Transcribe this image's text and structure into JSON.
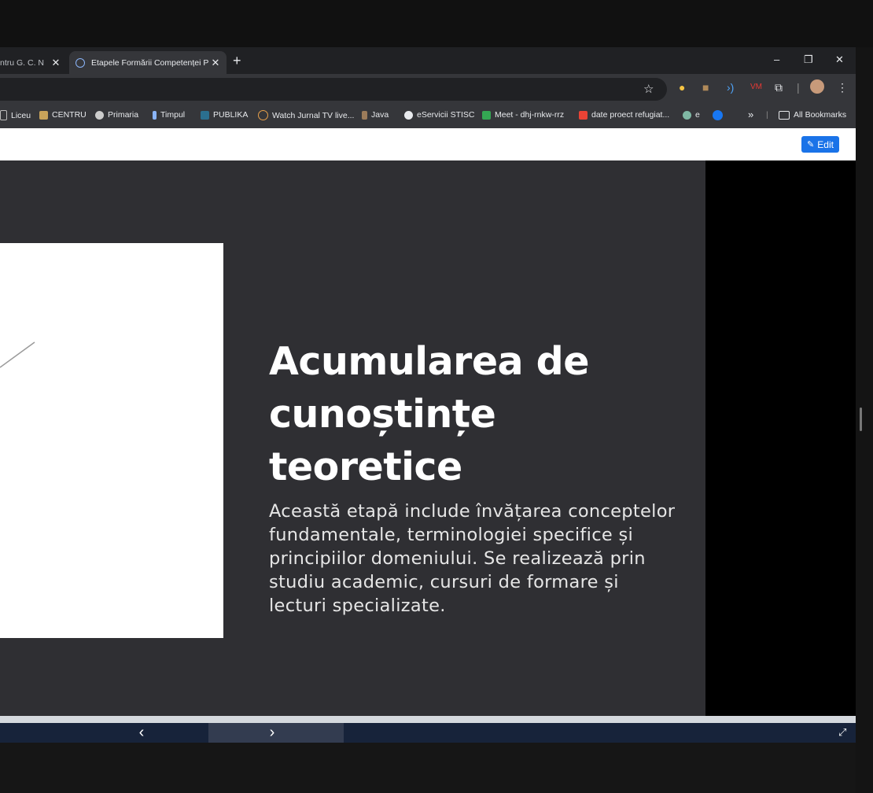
{
  "browser": {
    "tabs": [
      {
        "title": "ntru G. C. N",
        "active": false
      },
      {
        "title": "Etapele Formării Competenței P",
        "active": true
      }
    ],
    "new_tab": "+",
    "window_controls": {
      "minimize": "–",
      "restore": "❐",
      "close": "✕"
    },
    "bookmarks": [
      {
        "label": "Liceu",
        "icon": "page-icon"
      },
      {
        "label": "CENTRU",
        "icon": "folder-icon"
      },
      {
        "label": "Primaria",
        "icon": "wordpress-icon"
      },
      {
        "label": "Timpul",
        "icon": "timpul-icon"
      },
      {
        "label": "PUBLIKA",
        "icon": "publika-icon"
      },
      {
        "label": "Watch Jurnal TV live...",
        "icon": "jurnal-icon"
      },
      {
        "label": "Java",
        "icon": "java-icon"
      },
      {
        "label": "eServicii STISC",
        "icon": "globe-icon"
      },
      {
        "label": "Meet - dhj-rnkw-rrz",
        "icon": "meet-icon"
      },
      {
        "label": "date proect refugiat...",
        "icon": "gmail-icon"
      },
      {
        "label": "e",
        "icon": "chatgpt-icon"
      },
      {
        "label": "",
        "icon": "facebook-icon"
      }
    ],
    "more_bookmarks": "»",
    "all_bookmarks": "All Bookmarks"
  },
  "page": {
    "edit_label": "Edit"
  },
  "slide": {
    "title": "Acumularea de cunoștințe teoretice",
    "body": "Această etapă include învățarea conceptelor fundamentale, terminologiei specifice și principiilor domeniului. Se realizează prin studiu academic, cursuri de formare și lecturi specializate."
  },
  "nav": {
    "prev": "‹",
    "next": "›",
    "fullscreen": "⤢"
  },
  "colors": {
    "slide_bg": "#2f2f33",
    "nav_bg": "#17233a",
    "accent": "#1a73e8"
  }
}
